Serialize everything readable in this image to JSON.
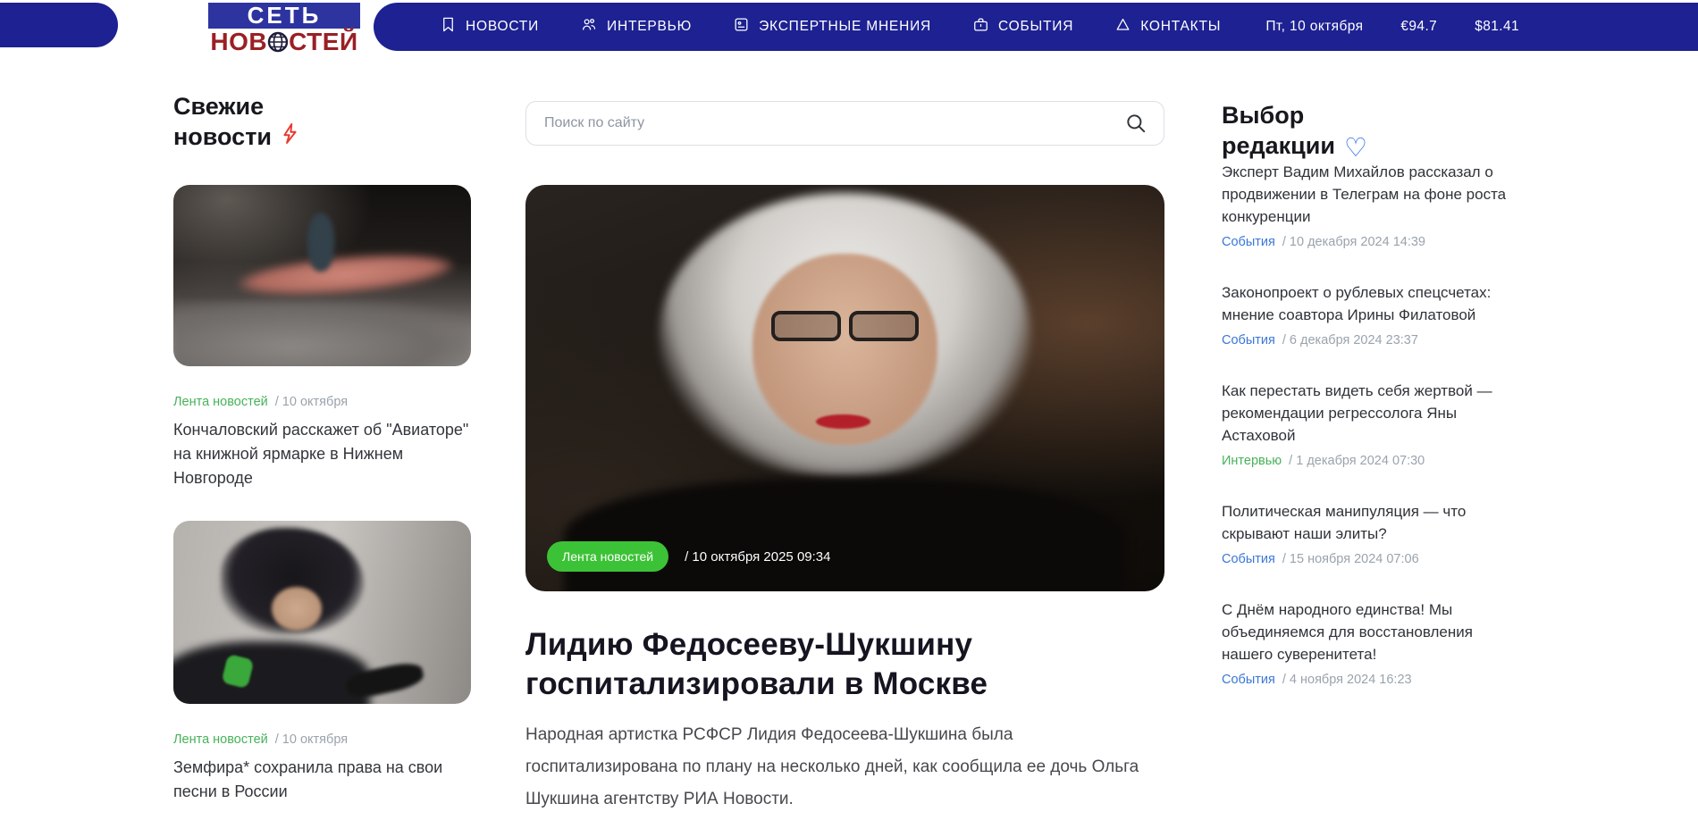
{
  "header": {
    "logo": {
      "line1": "СЕТЬ",
      "line2_pre": "НОВ",
      "line2_post": "СТЕЙ"
    },
    "nav": [
      {
        "label": "НОВОСТИ",
        "icon": "bookmark-icon"
      },
      {
        "label": "ИНТЕРВЬЮ",
        "icon": "people-icon"
      },
      {
        "label": "ЭКСПЕРТНЫЕ МНЕНИЯ",
        "icon": "card-icon"
      },
      {
        "label": "СОБЫТИЯ",
        "icon": "briefcase-icon"
      },
      {
        "label": "КОНТАКТЫ",
        "icon": "triangle-icon"
      }
    ],
    "date": "Пт, 10 октября",
    "eur_rate": "€94.7",
    "usd_rate": "$81.41"
  },
  "fresh": {
    "title_line1": "Свежие",
    "title_line2": "новости",
    "cards": [
      {
        "category": "Лента новостей",
        "date": "/ 10 октября",
        "title": "Кончаловский расскажет об \"Авиаторе\" на книжной ярмарке в Нижнем Новгороде"
      },
      {
        "category": "Лента новостей",
        "date": "/ 10 октября",
        "title": "Земфира* сохранила права на свои песни в России"
      }
    ]
  },
  "main": {
    "search_placeholder": "Поиск по сайту",
    "badge": "Лента новостей",
    "photo_date": "/ 10 октября 2025 09:34",
    "headline": "Лидию Федосееву-Шукшину госпитализировали в Москве",
    "body": "Народная артистка РСФСР Лидия Федосеева-Шукшина была госпитализирована по плану на несколько дней, как сообщила ее дочь Ольга Шукшина агентству РИА Новости."
  },
  "editors": {
    "title_line1": "Выбор",
    "title_line2": "редакции",
    "items": [
      {
        "title": "Эксперт Вадим Михайлов рассказал о продвижении в Телеграм на фоне роста конкуренции",
        "category": "События",
        "date": "/ 10 декабря 2024 14:39"
      },
      {
        "title": "Законопроект о рублевых спецсчетах: мнение соавтора Ирины Филатовой",
        "category": "События",
        "date": "/ 6 декабря 2024 23:37"
      },
      {
        "title": "Как перестать видеть себя жертвой — рекомендации регрессолога Яны Астаховой",
        "category": "Интервью",
        "date": "/ 1 декабря 2024 07:30"
      },
      {
        "title": "Политическая манипуляция — что скрывают наши элиты?",
        "category": "События",
        "date": "/ 15 ноября 2024 07:06"
      },
      {
        "title": "С Днём народного единства! Мы объединяемся для восстановления нашего суверенитета!",
        "category": "События",
        "date": "/ 4 ноября 2024 16:23"
      }
    ]
  },
  "icons": {
    "heart": "♡"
  },
  "colors": {
    "nav_blue": "#1d2191",
    "badge_blue": "#2d34a0",
    "logo_red": "#9a2025",
    "link_green": "#47b25a",
    "badge_green": "#3cc236",
    "link_blue": "#3b76d8",
    "heart_blue": "#2e6be6",
    "bolt_red": "#e8392e",
    "meta_gray": "#9aa3ad"
  }
}
